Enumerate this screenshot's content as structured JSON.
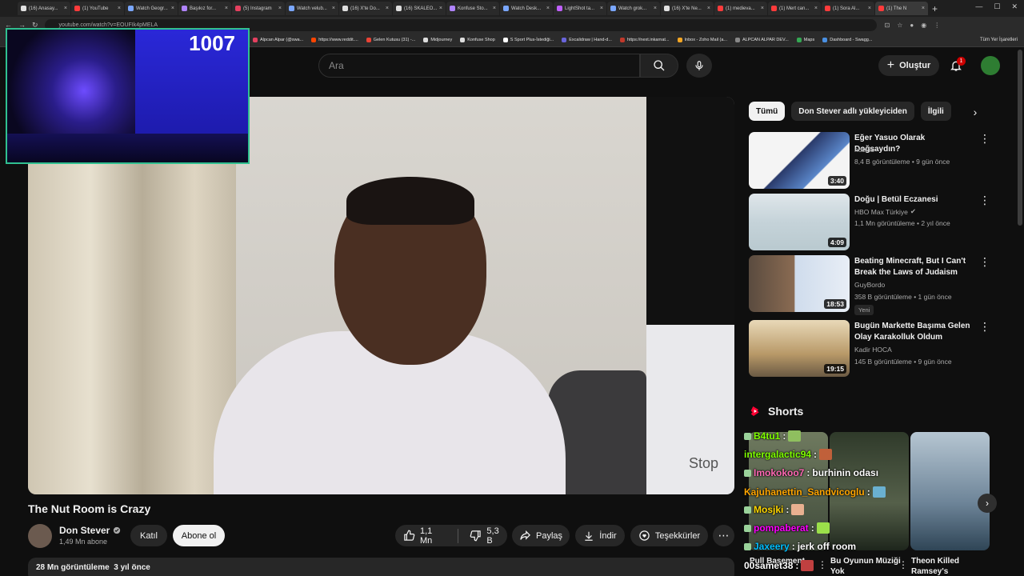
{
  "browser": {
    "tabs": [
      {
        "label": "(16) Anasay...",
        "color": "#e0e0e0",
        "active": false
      },
      {
        "label": "(1) YouTube",
        "color": "#ff3b3b",
        "active": false
      },
      {
        "label": "Watch Geogr...",
        "color": "#7aa7ff",
        "active": false
      },
      {
        "label": "Başıkız for...",
        "color": "#b084ff",
        "active": false
      },
      {
        "label": "(5) Instagram",
        "color": "#e4405f",
        "active": false
      },
      {
        "label": "Watch velub...",
        "color": "#7aa7ff",
        "active": false
      },
      {
        "label": "(16) X'te Do...",
        "color": "#e0e0e0",
        "active": false
      },
      {
        "label": "(16) SKALEO...",
        "color": "#e0e0e0",
        "active": false
      },
      {
        "label": "Konfuse Sto...",
        "color": "#b084ff",
        "active": false
      },
      {
        "label": "Watch Desk...",
        "color": "#7aa7ff",
        "active": false
      },
      {
        "label": "LightShot ta...",
        "color": "#c060ff",
        "active": false
      },
      {
        "label": "Watch grok...",
        "color": "#7aa7ff",
        "active": false
      },
      {
        "label": "(16) X'te Ne...",
        "color": "#e0e0e0",
        "active": false
      },
      {
        "label": "(1) medieva...",
        "color": "#ff3b3b",
        "active": false
      },
      {
        "label": "(1) Mert can...",
        "color": "#ff3b3b",
        "active": false
      },
      {
        "label": "(1) Sora Al...",
        "color": "#ff3b3b",
        "active": false
      },
      {
        "label": "(1) The N",
        "color": "#ff3b3b",
        "active": true
      }
    ],
    "url": "youtube.com/watch?v=EOUFIk4pMELA",
    "bookmarks": [
      {
        "label": "Alpcan Alpar (@swa...",
        "color": "#e4405f"
      },
      {
        "label": "https://www.reddit....",
        "color": "#ff4500"
      },
      {
        "label": "Gelen Kutusu (31) -...",
        "color": "#ea4335"
      },
      {
        "label": "Midjourney",
        "color": "#dddddd"
      },
      {
        "label": "Konfuse Shop",
        "color": "#dddddd"
      },
      {
        "label": "S Sport Plus-İstediği...",
        "color": "#ffffff"
      },
      {
        "label": "Excalidraw | Hand-d...",
        "color": "#6965db"
      },
      {
        "label": "https://next.inkarnat...",
        "color": "#c0392b"
      },
      {
        "label": "Inbox - Zoho Mail (a...",
        "color": "#f5a623"
      },
      {
        "label": "ALPCAN ALPAR DEV...",
        "color": "#888888"
      },
      {
        "label": "Maps",
        "color": "#34a853"
      },
      {
        "label": "Dashboard - Swagg...",
        "color": "#4a90e2"
      }
    ],
    "bookmarks_right": "Tüm Yer İşaretleri"
  },
  "header": {
    "search_placeholder": "Ara",
    "create_label": "Oluştur",
    "notification_count": "1"
  },
  "overlay": {
    "counter": "1007",
    "video_text": "Stop"
  },
  "video": {
    "title": "The Nut Room is Crazy",
    "channel": "Don Stever",
    "subscribers": "1,49 Mn abone",
    "join_label": "Katıl",
    "subscribe_label": "Abone ol",
    "likes": "1,1 Mn",
    "dislikes": "5,3 B",
    "share_label": "Paylaş",
    "download_label": "İndir",
    "thanks_label": "Teşekkürler",
    "views": "28 Mn görüntüleme",
    "age": "3 yıl önce"
  },
  "sidebar": {
    "chips": [
      {
        "label": "Tümü",
        "active": true
      },
      {
        "label": "Don Stever adlı yükleyiciden",
        "active": false
      },
      {
        "label": "İlgili",
        "active": false
      }
    ],
    "recommendations": [
      {
        "title": "Eğer Yasuo Olarak Doğsaydın?",
        "channel": "hubiris",
        "verified": false,
        "views": "8,4 B görüntüleme",
        "age": "9 gün önce",
        "duration": "3:40",
        "badge": ""
      },
      {
        "title": "Doğu | Betül Eczanesi",
        "channel": "HBO Max Türkiye",
        "verified": true,
        "views": "1,1 Mn görüntüleme",
        "age": "2 yıl önce",
        "duration": "4:09",
        "badge": ""
      },
      {
        "title": "Beating Minecraft, But I Can't Break the Laws of Judaism",
        "channel": "GuyBordo",
        "verified": false,
        "views": "358 B görüntüleme",
        "age": "1 gün önce",
        "duration": "18:53",
        "badge": "Yeni"
      },
      {
        "title": "Bugün Markette Başıma Gelen Olay Karakolluk Oldum",
        "channel": "Kadir HOCA",
        "verified": false,
        "views": "145 B görüntüleme",
        "age": "9 gün önce",
        "duration": "19:15",
        "badge": ""
      }
    ],
    "shorts_title": "Shorts",
    "shorts": [
      {
        "title": "Pull Basement..."
      },
      {
        "title": "Bu Oyunun Müziği Yok"
      },
      {
        "title": "Theon Killed Ramsey's"
      }
    ]
  },
  "chat": [
    {
      "user": "B4tu1",
      "message": "",
      "color": "#7fff00",
      "has_emote": true
    },
    {
      "user": "intergalactic94",
      "message": "",
      "color": "#7fff00",
      "has_emote": true
    },
    {
      "user": "Imokokoo7",
      "message": "burhinin odası",
      "color": "#ff69b4",
      "has_emote": false
    },
    {
      "user": "Kajuhanettin_Sandvicoglu",
      "message": "",
      "color": "#ffa500",
      "has_emote": true
    },
    {
      "user": "Mosjki",
      "message": "",
      "color": "#ffd700",
      "has_emote": true
    },
    {
      "user": "pompaberat",
      "message": "",
      "color": "#ff00ff",
      "has_emote": true
    },
    {
      "user": "Jaxeery",
      "message": "jerk off room",
      "color": "#00bfff",
      "has_emote": false
    },
    {
      "user": "00samet38",
      "message": "",
      "color": "#ffffff",
      "has_emote": true
    }
  ]
}
